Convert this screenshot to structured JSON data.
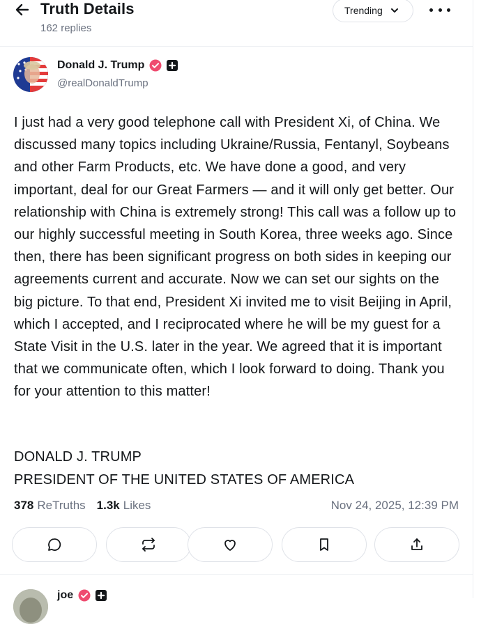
{
  "header": {
    "title": "Truth Details",
    "replies": "162 replies",
    "sort_label": "Trending"
  },
  "post": {
    "author_name": "Donald J. Trump",
    "author_handle": "@realDonaldTrump",
    "body": "I just had a very good telephone call with President Xi, of China. We discussed many topics including Ukraine/Russia, Fentanyl, Soybeans and other Farm Products, etc. We have done a good, and very important, deal for our Great Farmers — and it will only get better. Our relationship with China is extremely strong! This call was a follow up to our highly successful meeting in South Korea, three weeks ago. Since then, there has been significant progress on both sides in keeping our agreements current and accurate. Now we can set our sights on the big picture. To that end, President Xi invited me to visit Beijing in April, which I accepted, and I reciprocated where he will be my guest for a State Visit in the U.S. later in the year. We agreed that it is important that we communicate often, which I look forward to doing. Thank you for your attention to this matter!",
    "signature_line1": "DONALD J. TRUMP",
    "signature_line2": "PRESIDENT OF THE UNITED STATES OF AMERICA",
    "retruths_count": "378",
    "retruths_label": "ReTruths",
    "likes_count": "1.3k",
    "likes_label": "Likes",
    "timestamp": "Nov 24, 2025, 12:39 PM"
  },
  "actions": [
    {
      "icon": "reply-icon"
    },
    {
      "icon": "retruth-icon"
    },
    {
      "icon": "heart-icon"
    },
    {
      "icon": "bookmark-icon"
    },
    {
      "icon": "share-icon"
    }
  ],
  "next_reply": {
    "author_name": "joe"
  },
  "colors": {
    "verified_badge": "#ef4b6f",
    "text": "#14171a",
    "muted": "#6b7280",
    "border": "#dfe2e8"
  }
}
